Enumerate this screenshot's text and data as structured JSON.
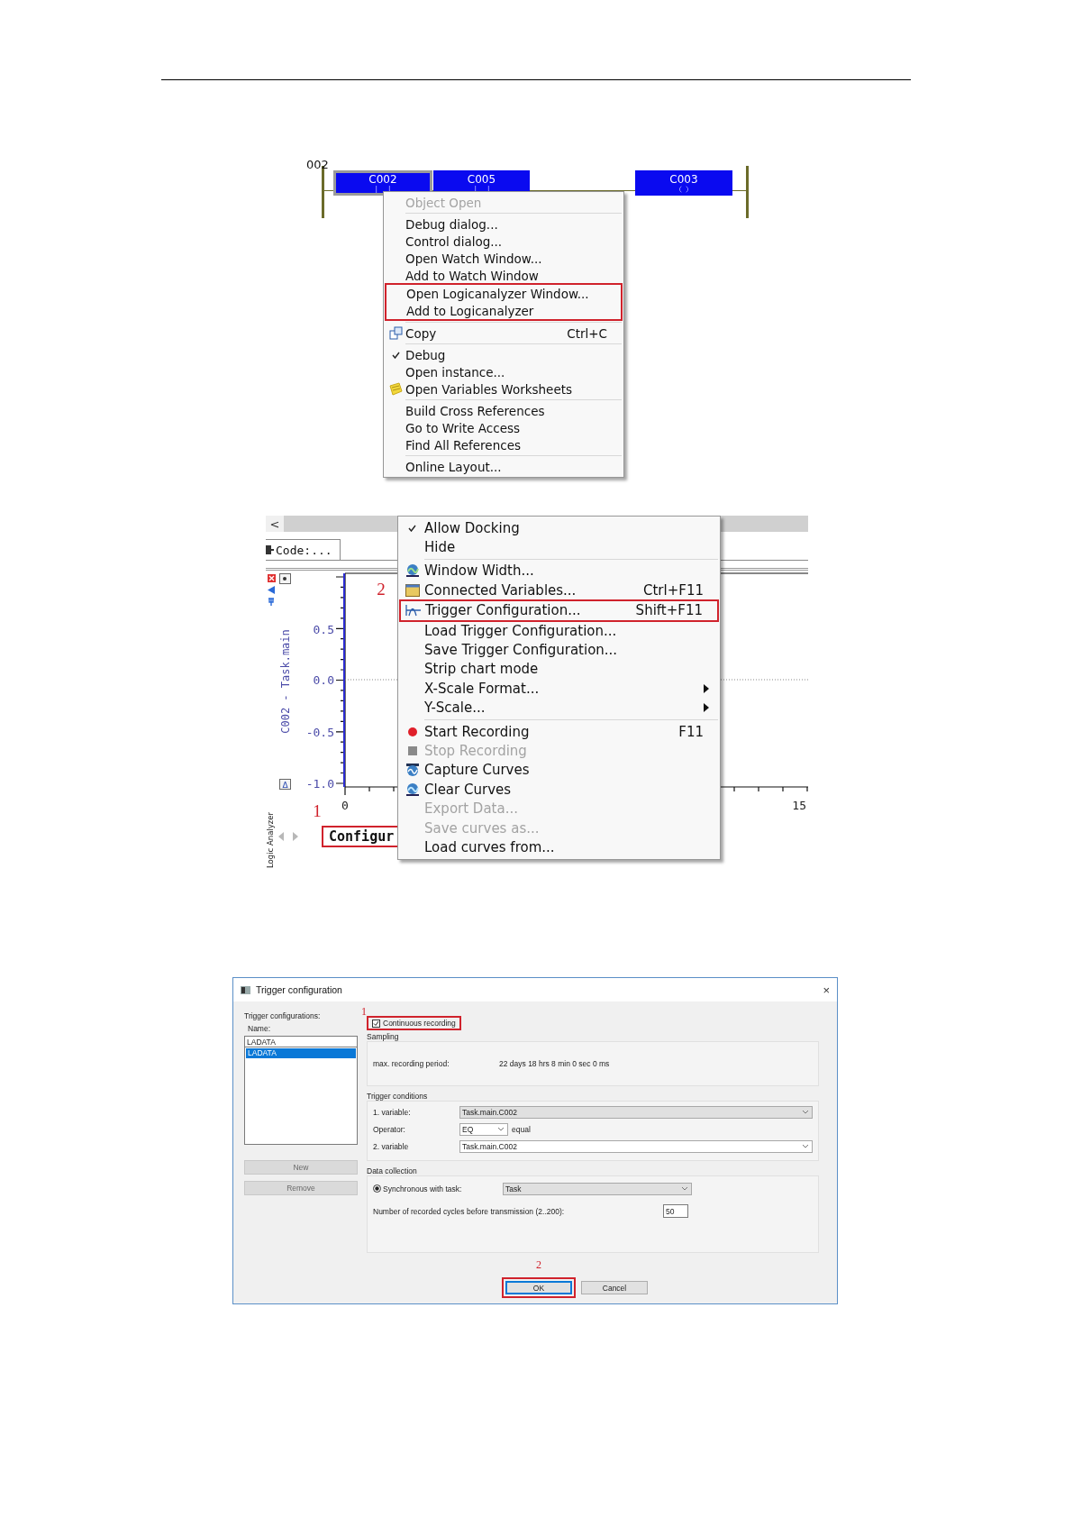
{
  "ladder": {
    "rung_label": "002",
    "elements": [
      {
        "kind": "contact",
        "label": "C002",
        "selected": true
      },
      {
        "kind": "contact",
        "label": "C005",
        "selected": false
      },
      {
        "kind": "coil",
        "label": "C003",
        "selected": false
      }
    ]
  },
  "object_menu": {
    "groups": [
      {
        "items": [
          {
            "kind": "plain",
            "label": "Object Open",
            "disabled": true,
            "highlighted": false
          }
        ]
      },
      {
        "items": [
          {
            "kind": "plain",
            "label": "Debug dialog...",
            "disabled": false,
            "highlighted": false
          },
          {
            "kind": "plain",
            "label": "Control dialog...",
            "disabled": false,
            "highlighted": false
          },
          {
            "kind": "plain",
            "label": "Open Watch Window...",
            "disabled": false,
            "highlighted": false
          },
          {
            "kind": "plain",
            "label": "Add to Watch Window",
            "disabled": false,
            "highlighted": false
          },
          {
            "kind": "plain",
            "label": "Open Logicanalyzer Window...",
            "disabled": false,
            "highlighted": true
          },
          {
            "kind": "plain",
            "label": "Add to Logicanalyzer",
            "disabled": false,
            "highlighted": true
          }
        ]
      },
      {
        "items": [
          {
            "kind": "icon",
            "label": "Copy",
            "shortcut": "Ctrl+C",
            "disabled": false,
            "highlighted": false
          }
        ]
      },
      {
        "items": [
          {
            "kind": "check",
            "label": "Debug",
            "checked": true,
            "disabled": false,
            "highlighted": false
          },
          {
            "kind": "plain",
            "label": "Open instance...",
            "disabled": false,
            "highlighted": false
          },
          {
            "kind": "icon",
            "label": "Open Variables Worksheets",
            "disabled": false,
            "highlighted": false
          }
        ]
      },
      {
        "items": [
          {
            "kind": "plain",
            "label": "Build Cross References",
            "disabled": false,
            "highlighted": false
          },
          {
            "kind": "plain",
            "label": "Go to Write Access",
            "disabled": false,
            "highlighted": false
          },
          {
            "kind": "plain",
            "label": "Find All References",
            "disabled": false,
            "highlighted": false
          }
        ]
      },
      {
        "items": [
          {
            "kind": "plain",
            "label": "Online Layout...",
            "disabled": false,
            "highlighted": false
          }
        ]
      }
    ]
  },
  "analyzer": {
    "scroll_button": "<",
    "tab": "Code:...",
    "y_label": "C002 - Task.main",
    "y_ticks": [
      "0.5",
      "0.0",
      "-0.5",
      "-1.0"
    ],
    "x_ticks": [
      "0",
      "15"
    ],
    "delta_button": "Δ",
    "side_label": "Logic Analyzer",
    "callouts": [
      "1",
      "2"
    ],
    "status": {
      "text": "Configur",
      "highlighted": true
    }
  },
  "analyzer_menu": {
    "groups": [
      {
        "items": [
          {
            "kind": "check",
            "label": "Allow Docking",
            "checked": true,
            "disabled": false,
            "highlighted": false
          },
          {
            "kind": "plain",
            "label": "Hide",
            "disabled": false,
            "highlighted": false
          }
        ]
      },
      {
        "items": [
          {
            "kind": "icon",
            "label": "Window Width...",
            "disabled": false,
            "highlighted": false
          },
          {
            "kind": "icon",
            "label": "Connected Variables...",
            "shortcut": "Ctrl+F11",
            "disabled": false,
            "highlighted": false
          },
          {
            "kind": "icon",
            "label": "Trigger Configuration...",
            "shortcut": "Shift+F11",
            "disabled": false,
            "highlighted": true
          },
          {
            "kind": "plain",
            "label": "Load Trigger Configuration...",
            "disabled": false,
            "highlighted": false
          },
          {
            "kind": "plain",
            "label": "Save Trigger Configuration...",
            "disabled": false,
            "highlighted": false
          },
          {
            "kind": "plain",
            "label": "Strip chart mode",
            "disabled": false,
            "highlighted": false
          },
          {
            "kind": "submenu",
            "label": "X-Scale Format...",
            "disabled": false,
            "highlighted": false
          },
          {
            "kind": "submenu",
            "label": "Y-Scale...",
            "disabled": false,
            "highlighted": false
          }
        ]
      },
      {
        "items": [
          {
            "kind": "icon",
            "label": "Start Recording",
            "shortcut": "F11",
            "disabled": false,
            "highlighted": false
          },
          {
            "kind": "icon",
            "label": "Stop Recording",
            "disabled": true,
            "highlighted": false
          },
          {
            "kind": "icon",
            "label": "Capture Curves",
            "disabled": false,
            "highlighted": false
          },
          {
            "kind": "icon",
            "label": "Clear Curves",
            "disabled": false,
            "highlighted": false
          },
          {
            "kind": "plain",
            "label": "Export Data...",
            "disabled": true,
            "highlighted": false
          },
          {
            "kind": "plain",
            "label": "Save curves as...",
            "disabled": true,
            "highlighted": false
          },
          {
            "kind": "plain",
            "label": "Load curves from...",
            "disabled": false,
            "highlighted": false
          }
        ]
      }
    ]
  },
  "dialog": {
    "title": "Trigger configuration",
    "close": "×",
    "configs_label": "Trigger configurations:",
    "name_label": "Name:",
    "name_value": "LADATA",
    "list": [
      {
        "label": "LADATA",
        "selected": true
      }
    ],
    "side_buttons": [
      {
        "label": "New",
        "disabled": true
      },
      {
        "label": "Remove",
        "disabled": true
      }
    ],
    "callout_1": "1",
    "continuous": {
      "label": "Continuous recording",
      "checked": true,
      "highlighted": true
    },
    "sampling": {
      "title": "Sampling",
      "label": "max. recording period:",
      "value": "22 days 18 hrs 8 min 0 sec 0 ms"
    },
    "trigger": {
      "title": "Trigger conditions",
      "rows": [
        {
          "kind": "wide",
          "label": "1. variable:",
          "value": "Task.main.C002",
          "disabled": true
        },
        {
          "kind": "small",
          "label": "Operator:",
          "value": "EQ",
          "note": "equal",
          "disabled": false
        },
        {
          "kind": "wide",
          "label": "2. variable",
          "value": "Task.main.C002",
          "disabled": false
        }
      ]
    },
    "collection": {
      "title": "Data collection",
      "radio": {
        "label": "Synchronous with task:",
        "selected": true
      },
      "task": "Task",
      "cycles_label": "Number of recorded cycles before transmission (2..200):",
      "cycles_value": "50"
    },
    "callout_2": "2",
    "buttons": [
      {
        "label": "OK",
        "highlighted": true
      },
      {
        "label": "Cancel",
        "highlighted": false
      }
    ]
  }
}
